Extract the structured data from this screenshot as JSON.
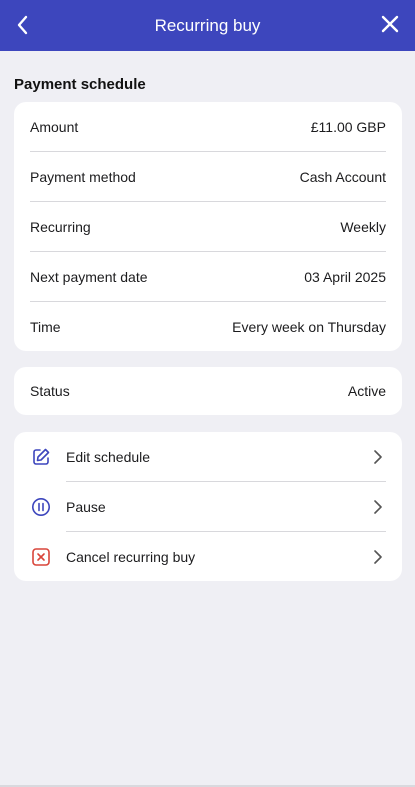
{
  "header": {
    "title": "Recurring buy",
    "back_icon": "chevron-left-icon",
    "close_icon": "close-icon",
    "background": "#3d46bd"
  },
  "schedule": {
    "section_title": "Payment schedule",
    "rows": [
      {
        "label": "Amount",
        "value": "£11.00 GBP"
      },
      {
        "label": "Payment method",
        "value": "Cash Account"
      },
      {
        "label": "Recurring",
        "value": "Weekly"
      },
      {
        "label": "Next payment date",
        "value": "03 April 2025"
      },
      {
        "label": "Time",
        "value": "Every week on Thursday"
      }
    ]
  },
  "status": {
    "label": "Status",
    "value": "Active",
    "color": "#2e9a4a"
  },
  "actions": [
    {
      "label": "Edit schedule",
      "icon": "edit-icon",
      "color": "#3d46bd"
    },
    {
      "label": "Pause",
      "icon": "pause-icon",
      "color": "#3d46bd"
    },
    {
      "label": "Cancel recurring buy",
      "icon": "cancel-icon",
      "color": "#d9453a"
    }
  ]
}
